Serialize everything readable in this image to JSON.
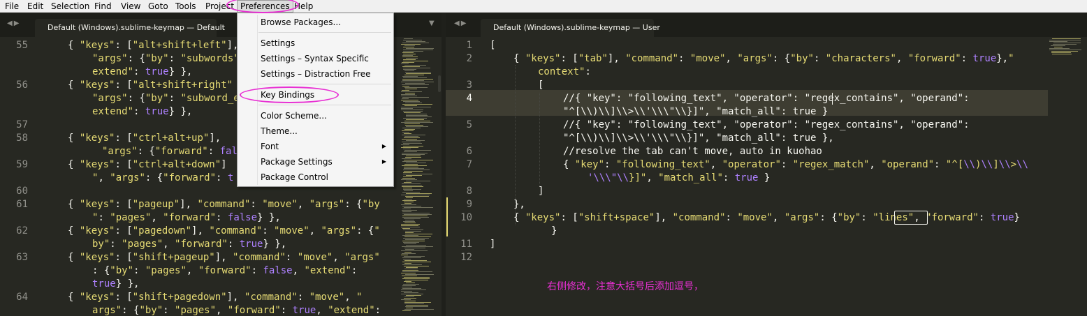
{
  "menubar": {
    "items": [
      "File",
      "Edit",
      "Selection",
      "Find",
      "View",
      "Goto",
      "Tools",
      "Project",
      "Preferences",
      "Help"
    ]
  },
  "left_tab": {
    "title": "Default (Windows).sublime-keymap — Default"
  },
  "right_tab": {
    "title": "Default (Windows).sublime-keymap — User"
  },
  "preferences_menu": {
    "items": [
      "Browse Packages...",
      "Settings",
      "Settings – Syntax Specific",
      "Settings – Distraction Free",
      "Key Bindings",
      "Color Scheme...",
      "Theme...",
      "Font",
      "Package Settings",
      "Package Control"
    ]
  },
  "left_editor": {
    "line_numbers": [
      "55",
      "56",
      "57",
      "58",
      "59",
      "60",
      "61",
      "62",
      "63",
      "64"
    ]
  },
  "right_editor": {
    "line_numbers": [
      "1",
      "2",
      "3",
      "4",
      "5",
      "6",
      "7",
      "8",
      "9",
      "10",
      "11",
      "12"
    ]
  },
  "annotation": {
    "text": "右侧修改，注意大括号后添加逗号，"
  },
  "colors": {
    "background": "#272822",
    "string": "#e6db74",
    "constant": "#ae81ff",
    "comment": "#75715e",
    "annotation": "#e830d3"
  }
}
